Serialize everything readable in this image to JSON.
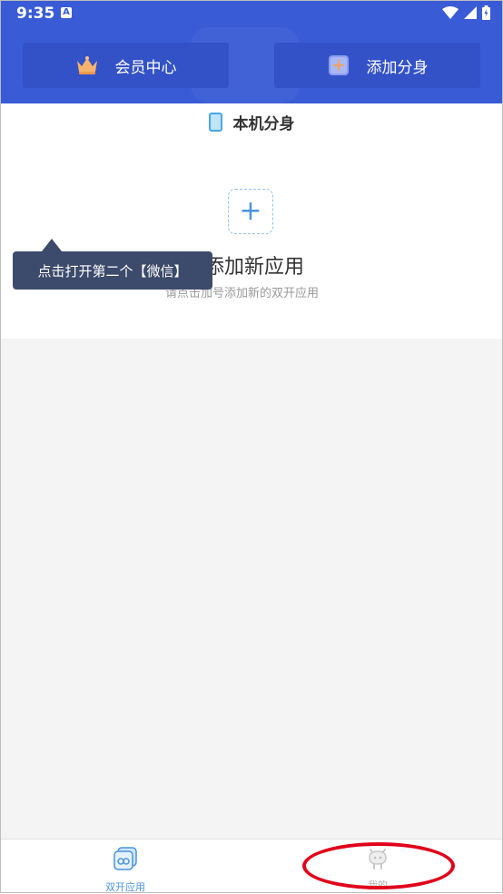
{
  "status_bar": {
    "time": "9:35",
    "notification_letter": "A"
  },
  "header": {
    "vip_label": "会员中心",
    "add_clone_label": "添加分身"
  },
  "local_section": {
    "title": "本机分身"
  },
  "add_app": {
    "plus": "+",
    "title": "添加新应用",
    "subtitle": "请点击加号添加新的双开应用"
  },
  "tooltip": {
    "text": "点击打开第二个【微信】"
  },
  "bottom_nav": [
    {
      "label": "双开应用",
      "icon": "dual-apps-icon",
      "active": true
    },
    {
      "label": "我的",
      "icon": "profile-icon",
      "active": false
    }
  ],
  "colors": {
    "primary": "#3a5bd6",
    "tooltip_bg": "#3c4a6b",
    "active_tab": "#4a93e0",
    "annotation": "#e0001a"
  }
}
